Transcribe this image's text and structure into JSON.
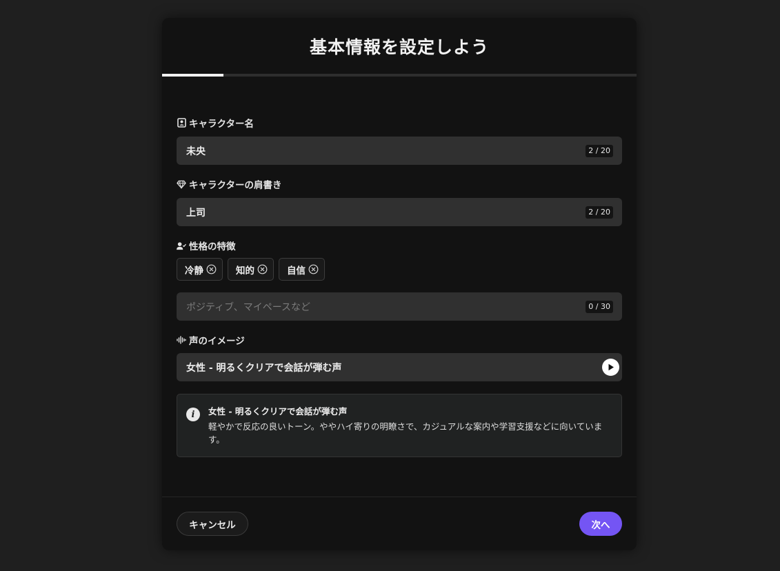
{
  "modal": {
    "title": "基本情報を設定しよう",
    "progress_percent": 13
  },
  "fields": {
    "character_name": {
      "label": "キャラクター名",
      "icon": "id-card-icon",
      "value": "未央",
      "counter": "2 / 20"
    },
    "character_title": {
      "label": "キャラクターの肩書き",
      "icon": "diamond-icon",
      "value": "上司",
      "counter": "2 / 20"
    },
    "personality": {
      "label": "性格の特徴",
      "icon": "user-check-icon",
      "tags": [
        "冷静",
        "知的",
        "自信"
      ],
      "placeholder": "ポジティブ、マイペースなど",
      "counter": "0 / 30"
    },
    "voice": {
      "label": "声のイメージ",
      "icon": "waveform-icon",
      "value": "女性 - 明るくクリアで会話が弾む声",
      "play_icon": "play-icon"
    }
  },
  "info": {
    "icon": "info-icon",
    "title": "女性 - 明るくクリアで会話が弾む声",
    "description": "軽やかで反応の良いトーン。ややハイ寄りの明瞭さで、カジュアルな案内や学習支援などに向いています。"
  },
  "footer": {
    "cancel_label": "キャンセル",
    "next_label": "次へ"
  },
  "colors": {
    "background": "#1f1f1f",
    "modal": "#121212",
    "input": "#303030",
    "accent": "#7455f4"
  }
}
